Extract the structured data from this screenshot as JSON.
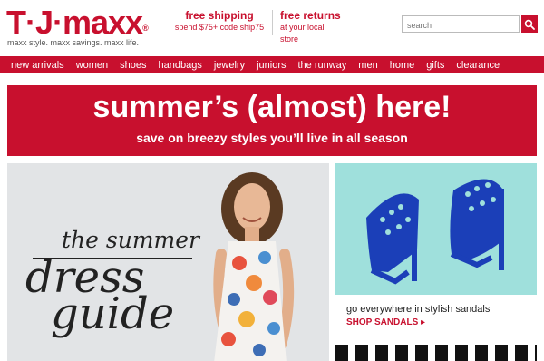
{
  "brand": {
    "logo": "T·J·maxx",
    "tagline": "maxx style. maxx savings. maxx life."
  },
  "promos": [
    {
      "title": "free shipping",
      "sub": "spend $75+ code ship75"
    },
    {
      "title": "free returns",
      "sub": "at your local store"
    }
  ],
  "search": {
    "placeholder": "search"
  },
  "nav": [
    "new arrivals",
    "women",
    "shoes",
    "handbags",
    "jewelry",
    "juniors",
    "the runway",
    "men",
    "home",
    "gifts",
    "clearance"
  ],
  "banner": {
    "headline": "summer’s (almost) here!",
    "subhead": "save on breezy styles you’ll live in all season"
  },
  "hero": {
    "line1": "the summer",
    "line2": "dress",
    "line3": "guide"
  },
  "sandals": {
    "caption": "go everywhere in stylish sandals",
    "cta": "SHOP SANDALS ▸"
  },
  "colors": {
    "brand": "#c8102e",
    "sandals_bg": "#9fe0dc",
    "hero_bg": "#e2e4e6"
  }
}
